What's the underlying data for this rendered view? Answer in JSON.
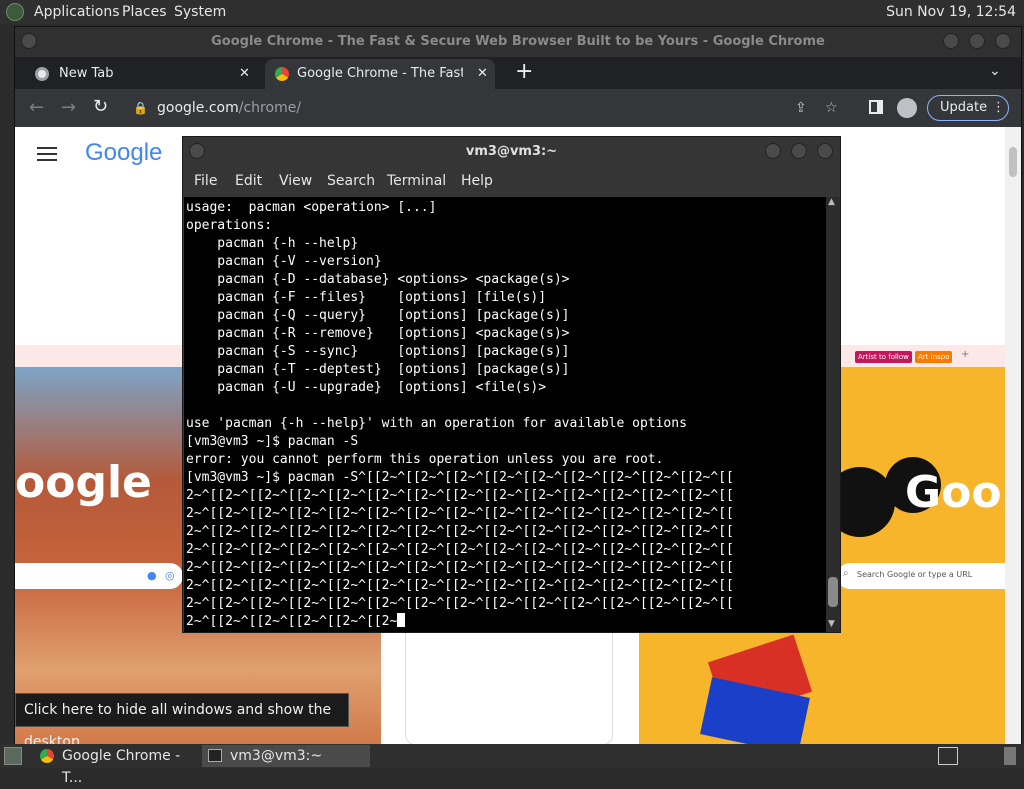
{
  "top_panel": {
    "menus": [
      "Applications",
      "Places",
      "System"
    ],
    "clock": "Sun Nov 19, 12:54"
  },
  "chrome": {
    "window_title": "Google Chrome - The Fast & Secure Web Browser Built to be Yours - Google Chrome",
    "tabs": [
      {
        "label": "New Tab"
      },
      {
        "label": "Google Chrome - The Fast & S"
      }
    ],
    "url_host": "google.com",
    "url_path": "/chrome/",
    "update_label": "Update",
    "page": {
      "logo_text": "Google",
      "chips": [
        "Artist to follow",
        "Art inspo"
      ],
      "search_placeholder": "Search Google or type a URL",
      "card_logo_left": "oogle",
      "card_logo_right": "Goo"
    }
  },
  "terminal": {
    "title": "vm3@vm3:~",
    "menus": [
      "File",
      "Edit",
      "View",
      "Search",
      "Terminal",
      "Help"
    ],
    "lines": [
      "usage:  pacman <operation> [...]",
      "operations:",
      "    pacman {-h --help}",
      "    pacman {-V --version}",
      "    pacman {-D --database} <options> <package(s)>",
      "    pacman {-F --files}    [options] [file(s)]",
      "    pacman {-Q --query}    [options] [package(s)]",
      "    pacman {-R --remove}   [options] <package(s)>",
      "    pacman {-S --sync}     [options] [package(s)]",
      "    pacman {-T --deptest}  [options] [package(s)]",
      "    pacman {-U --upgrade}  [options] <file(s)>",
      "",
      "use 'pacman {-h --help}' with an operation for available options",
      "[vm3@vm3 ~]$ pacman -S",
      "error: you cannot perform this operation unless you are root.",
      "[vm3@vm3 ~]$ pacman -S^[[2~^[[2~^[[2~^[[2~^[[2~^[[2~^[[2~^[[2~^[[2~^[[",
      "2~^[[2~^[[2~^[[2~^[[2~^[[2~^[[2~^[[2~^[[2~^[[2~^[[2~^[[2~^[[2~^[[2~^[[",
      "2~^[[2~^[[2~^[[2~^[[2~^[[2~^[[2~^[[2~^[[2~^[[2~^[[2~^[[2~^[[2~^[[2~^[[",
      "2~^[[2~^[[2~^[[2~^[[2~^[[2~^[[2~^[[2~^[[2~^[[2~^[[2~^[[2~^[[2~^[[2~^[[",
      "2~^[[2~^[[2~^[[2~^[[2~^[[2~^[[2~^[[2~^[[2~^[[2~^[[2~^[[2~^[[2~^[[2~^[[",
      "2~^[[2~^[[2~^[[2~^[[2~^[[2~^[[2~^[[2~^[[2~^[[2~^[[2~^[[2~^[[2~^[[2~^[[",
      "2~^[[2~^[[2~^[[2~^[[2~^[[2~^[[2~^[[2~^[[2~^[[2~^[[2~^[[2~^[[2~^[[2~^[[",
      "2~^[[2~^[[2~^[[2~^[[2~^[[2~^[[2~^[[2~^[[2~^[[2~^[[2~^[[2~^[[2~^[[2~^[[",
      "2~^[[2~^[[2~^[[2~^[[2~^[[2~"
    ]
  },
  "tooltip": "Click here to hide all windows and show the desktop.",
  "taskbar": {
    "tasks": [
      {
        "label": "Google Chrome - T..."
      },
      {
        "label": "vm3@vm3:~"
      }
    ]
  },
  "colors": {
    "chrome_dark": "#35363a",
    "accent_blue": "#8ab4f8",
    "terminal_bg": "#000000"
  }
}
